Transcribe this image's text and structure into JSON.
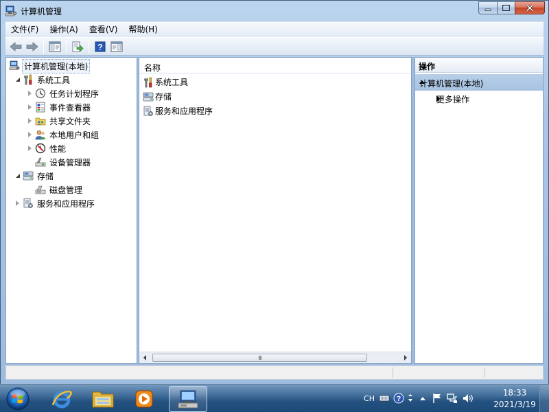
{
  "window": {
    "title": "计算机管理",
    "caption_buttons": [
      "minimize",
      "maximize",
      "close"
    ]
  },
  "menu": [
    {
      "label": "文件(F)"
    },
    {
      "label": "操作(A)"
    },
    {
      "label": "查看(V)"
    },
    {
      "label": "帮助(H)"
    }
  ],
  "toolbar": {
    "icons": [
      "back-arrow-icon",
      "forward-arrow-icon",
      "show-hide-tree-icon",
      "export-list-icon",
      "help-icon",
      "show-hide-action-pane-icon"
    ]
  },
  "tree": {
    "root": "计算机管理(本地)",
    "items": [
      {
        "label": "系统工具",
        "level": 1,
        "expander": "open",
        "icon": "tools-icon"
      },
      {
        "label": "任务计划程序",
        "level": 2,
        "expander": "closed",
        "icon": "clock-icon"
      },
      {
        "label": "事件查看器",
        "level": 2,
        "expander": "closed",
        "icon": "event-viewer-icon"
      },
      {
        "label": "共享文件夹",
        "level": 2,
        "expander": "closed",
        "icon": "shared-folder-icon"
      },
      {
        "label": "本地用户和组",
        "level": 2,
        "expander": "closed",
        "icon": "users-icon"
      },
      {
        "label": "性能",
        "level": 2,
        "expander": "closed",
        "icon": "performance-icon"
      },
      {
        "label": "设备管理器",
        "level": 2,
        "expander": "none",
        "icon": "device-manager-icon"
      },
      {
        "label": "存储",
        "level": 1,
        "expander": "open",
        "icon": "storage-icon"
      },
      {
        "label": "磁盘管理",
        "level": 2,
        "expander": "none",
        "icon": "disk-management-icon"
      },
      {
        "label": "服务和应用程序",
        "level": 1,
        "expander": "closed",
        "icon": "services-icon"
      }
    ]
  },
  "list": {
    "column_header": "名称",
    "items": [
      {
        "label": "系统工具",
        "icon": "tools-icon"
      },
      {
        "label": "存储",
        "icon": "storage-icon"
      },
      {
        "label": "服务和应用程序",
        "icon": "services-icon"
      }
    ],
    "scroll_grip": "III"
  },
  "actions": {
    "title": "操作",
    "section": "计算机管理(本地)",
    "items": [
      {
        "label": "更多操作"
      }
    ]
  },
  "taskbar": {
    "apps": [
      "internet-explorer-icon",
      "windows-explorer-icon",
      "media-player-icon",
      "computer-management-icon"
    ],
    "language": "CH",
    "time": "18:33",
    "date": "2021/3/19"
  },
  "colors": {
    "window_frame": "#a9c6e6",
    "selection": "#a7c2e1",
    "taskbar": "#24517f"
  }
}
